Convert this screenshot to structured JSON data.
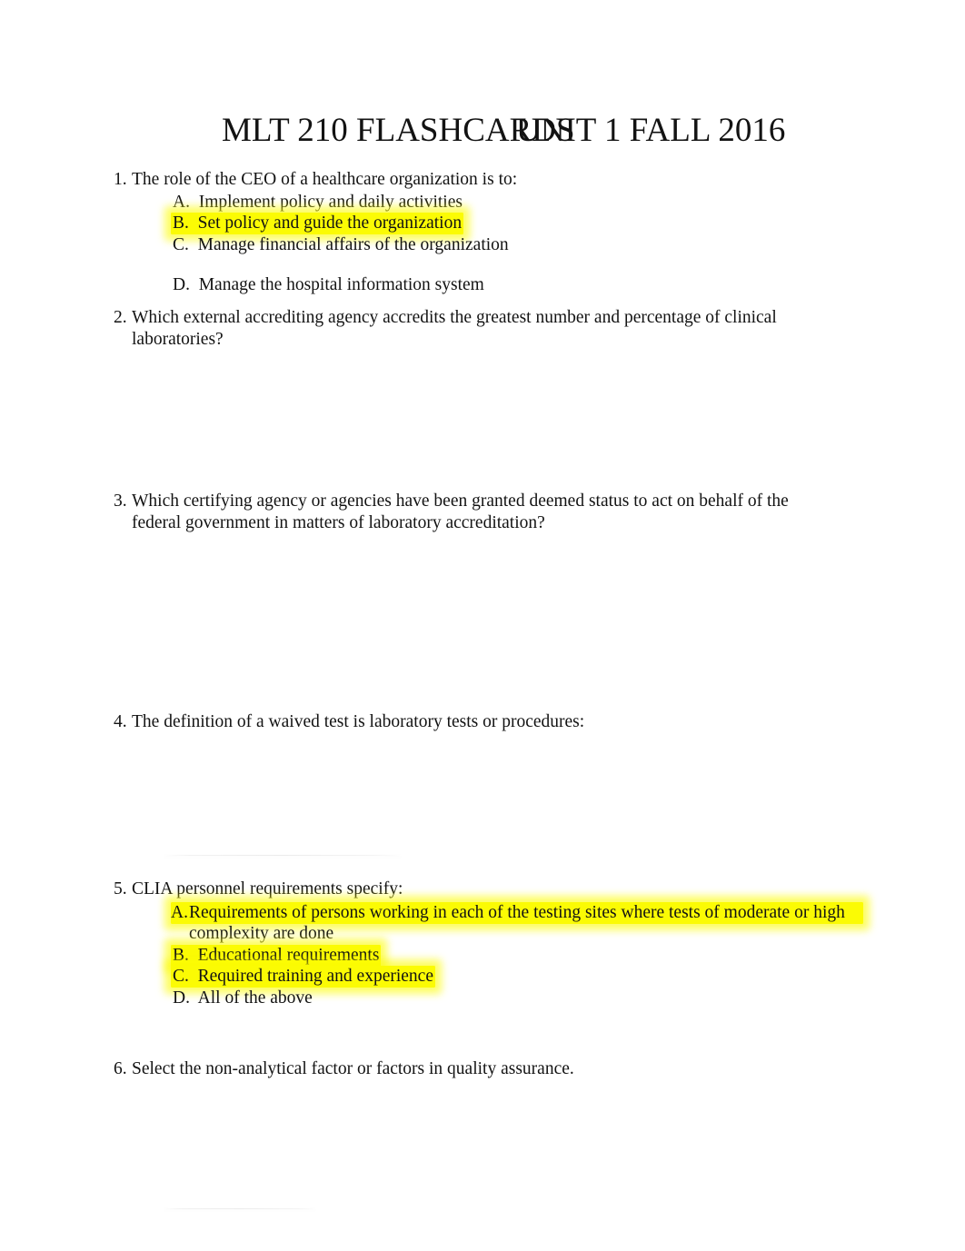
{
  "document": {
    "title_line_1": "MLT 210 FLASHCARDS",
    "title_line_2": "UNIT 1 FALL 2016",
    "highlight_color": "#FBFB04",
    "text_color": "#131313"
  },
  "questions": [
    {
      "number": "1.",
      "stem": "The role of the CEO of a healthcare organization is to:",
      "options": [
        {
          "letter": "A.",
          "text": "Implement policy and daily activities",
          "highlighted": false
        },
        {
          "letter": "B.",
          "text": "Set policy and guide the organization",
          "highlighted": true
        },
        {
          "letter": "C.",
          "text": "Manage financial affairs of the organization",
          "highlighted": false
        },
        {
          "letter": "D.",
          "text": "Manage the hospital information system",
          "highlighted": false
        }
      ]
    },
    {
      "number": "2.",
      "stem": "Which external accrediting agency accredits the greatest number and percentage of clinical laboratories?",
      "options": []
    },
    {
      "number": "3.",
      "stem": "Which certifying agency or agencies have been granted deemed status to act on behalf of the federal government in matters of laboratory accreditation?",
      "options": []
    },
    {
      "number": "4.",
      "stem": "The definition of a waived test is laboratory tests or procedures:",
      "options": []
    },
    {
      "number": "5.",
      "stem": "CLIA personnel requirements specify:",
      "options": [
        {
          "letter": "A.",
          "text": "Requirements of persons working in each of the testing sites where tests of moderate or high complexity are done",
          "highlighted": true
        },
        {
          "letter": "B.",
          "text": "Educational requirements",
          "highlighted": true
        },
        {
          "letter": "C.",
          "text": "Required training and experience",
          "highlighted": true
        },
        {
          "letter": "D.",
          "text": "All of the above",
          "highlighted": false
        }
      ]
    },
    {
      "number": "6.",
      "stem": "Select the non-analytical factor or factors in quality assurance.",
      "options": []
    }
  ],
  "separators": [
    {
      "name": "rule-above-question-5"
    },
    {
      "name": "rule-below-question-6"
    }
  ]
}
